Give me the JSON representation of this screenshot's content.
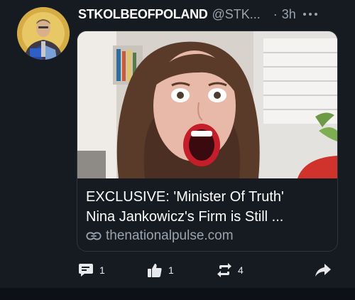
{
  "post": {
    "author": {
      "display_name": "STKOLBEOFPOLAND",
      "handle": "@STK...",
      "avatar_icon": "saint-portrait-avatar"
    },
    "separator": "·",
    "time": "3h",
    "more_icon": "ellipsis-icon",
    "link_card": {
      "title_line1": "EXCLUSIVE: 'Minister Of Truth'",
      "title_line2": "Nina Jankowicz's Firm is Still ...",
      "domain": "thenationalpulse.com",
      "domain_icon": "link-icon"
    },
    "actions": {
      "reply": {
        "icon": "comment-icon",
        "count": "1"
      },
      "like": {
        "icon": "thumbs-up-icon",
        "count": "1"
      },
      "repost": {
        "icon": "repost-icon",
        "count": "4"
      },
      "share": {
        "icon": "share-arrow-icon"
      }
    }
  },
  "colors": {
    "background": "#161b22",
    "text": "#e7e9ea",
    "muted": "#9aa4ae",
    "card_border": "#2f353d"
  }
}
